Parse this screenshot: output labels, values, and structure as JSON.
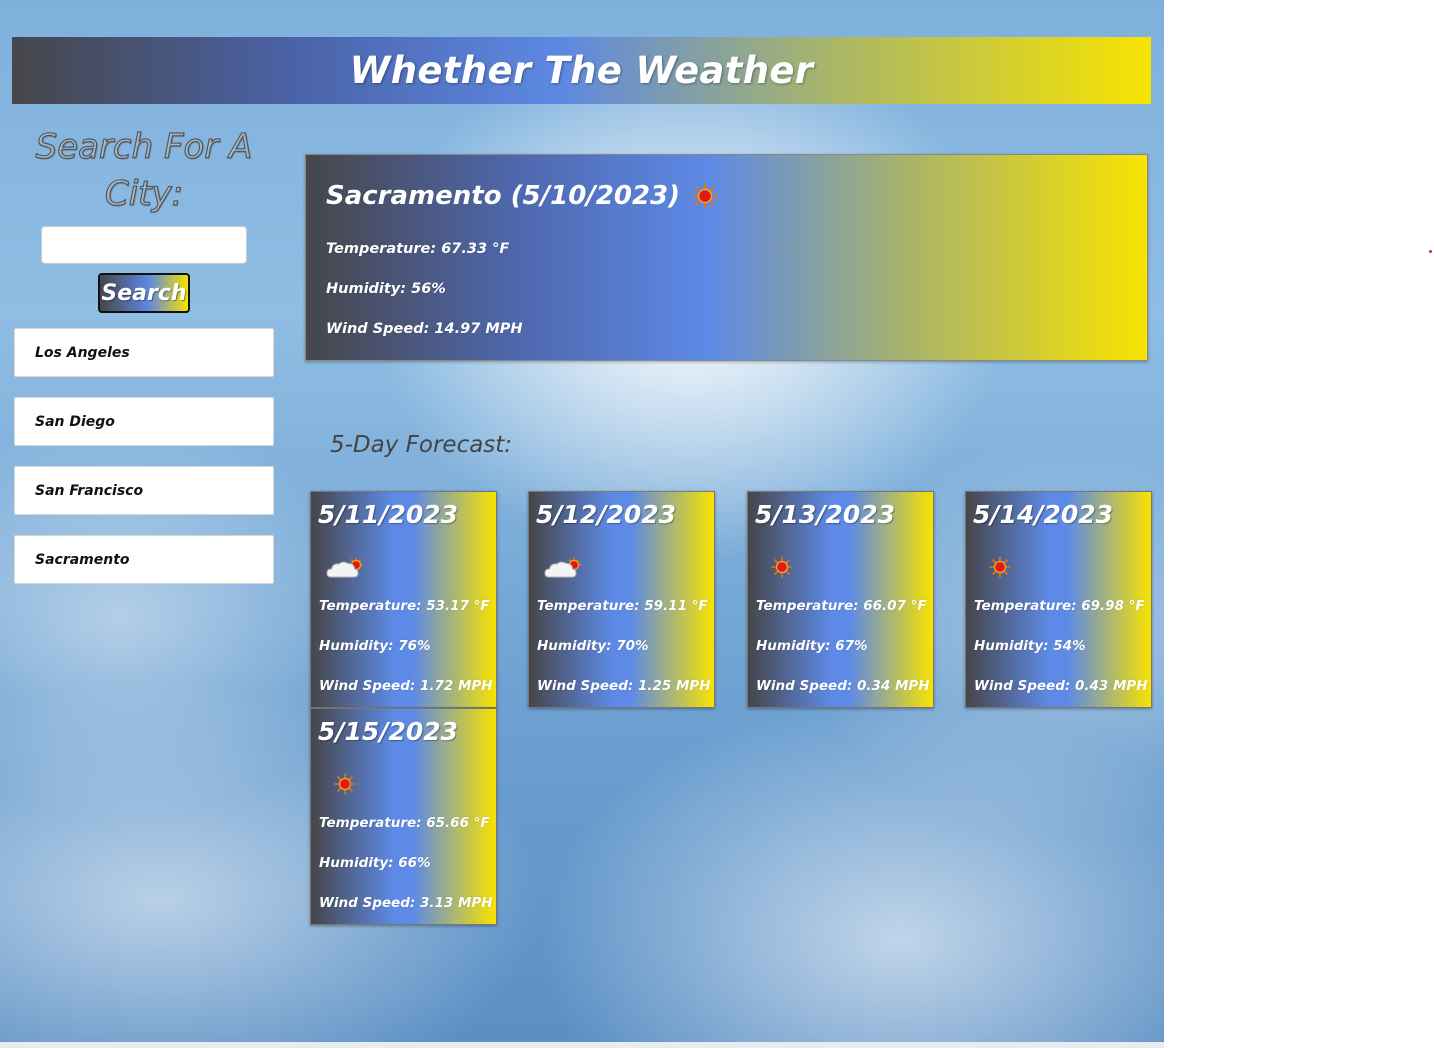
{
  "app": {
    "title": "Whether The Weather"
  },
  "search": {
    "heading_line1": "Search For A",
    "heading_line2": "City:",
    "input_value": "",
    "button_label": "Search"
  },
  "history": [
    {
      "label": "Los Angeles"
    },
    {
      "label": "San Diego"
    },
    {
      "label": "San Francisco"
    },
    {
      "label": "Sacramento"
    }
  ],
  "current": {
    "title": "Sacramento (5/10/2023)",
    "icon": "sun-icon",
    "temperature": "Temperature: 67.33 °F",
    "humidity": "Humidity: 56%",
    "wind": "Wind Speed: 14.97 MPH"
  },
  "forecast": {
    "heading": "5-Day Forecast:",
    "days": [
      {
        "date": "5/11/2023",
        "icon": "partly-cloudy-icon",
        "temperature": "Temperature: 53.17 °F",
        "humidity": "Humidity: 76%",
        "wind": "Wind Speed: 1.72 MPH"
      },
      {
        "date": "5/12/2023",
        "icon": "partly-cloudy-icon",
        "temperature": "Temperature: 59.11 °F",
        "humidity": "Humidity: 70%",
        "wind": "Wind Speed: 1.25 MPH"
      },
      {
        "date": "5/13/2023",
        "icon": "sun-icon",
        "temperature": "Temperature: 66.07 °F",
        "humidity": "Humidity: 67%",
        "wind": "Wind Speed: 0.34 MPH"
      },
      {
        "date": "5/14/2023",
        "icon": "sun-icon",
        "temperature": "Temperature: 69.98 °F",
        "humidity": "Humidity: 54%",
        "wind": "Wind Speed: 0.43 MPH"
      },
      {
        "date": "5/15/2023",
        "icon": "sun-icon",
        "temperature": "Temperature: 65.66 °F",
        "humidity": "Humidity: 66%",
        "wind": "Wind Speed: 3.13 MPH"
      }
    ]
  },
  "colors": {
    "gradient_dark": "#46464a",
    "gradient_blue": "#5d88e2",
    "gradient_yellow": "#f7e301"
  }
}
